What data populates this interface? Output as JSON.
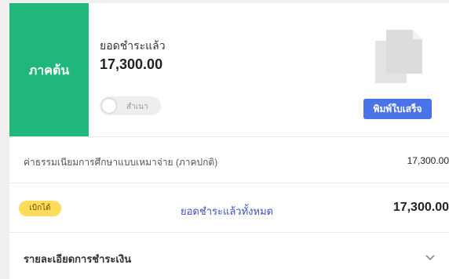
{
  "semester": {
    "label": "ภาคต้น"
  },
  "payment": {
    "paid_label": "ยอดชำระแล้ว",
    "paid_amount": "17,300.00",
    "toggle_label": "สำเนา",
    "print_button_label": "พิมพ์ใบเสร็จ"
  },
  "fee": {
    "label": "ค่าธรรมเนียมการศึกษาแบบเหมาจ่าย (ภาคปกติ)",
    "amount": "17,300.00"
  },
  "total": {
    "status_badge": "เบิกได้",
    "label": "ยอดชำระแล้วทั้งหมด",
    "amount": "17,300.00"
  },
  "details": {
    "label": "รายละเอียดการชำระเงิน"
  },
  "colors": {
    "semester_bg": "#1fb87a",
    "print_button": "#4a73e8",
    "status_badge": "#ffdd5a",
    "total_label": "#3a52c4"
  },
  "icons": {
    "document": "document-copy-icon",
    "chevron": "chevron-down-icon"
  }
}
